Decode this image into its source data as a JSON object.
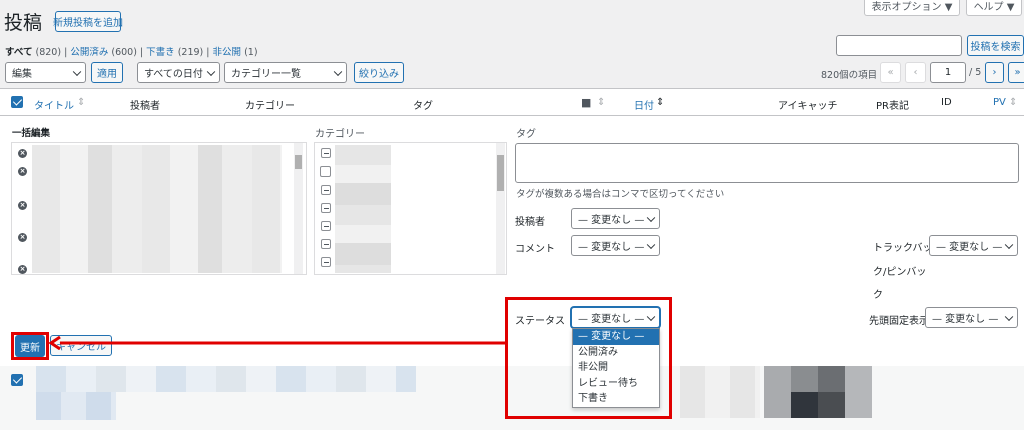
{
  "header": {
    "title": "投稿",
    "add_new": "新規投稿を追加",
    "screen_options": "表示オプション ▼",
    "help": "ヘルプ ▼"
  },
  "filters": {
    "all": "すべて",
    "all_count": "(820)",
    "published": "公開済み",
    "published_count": "(600)",
    "drafts": "下書き",
    "drafts_count": "(219)",
    "private": "非公開",
    "private_count": "(1)"
  },
  "search": {
    "button": "投稿を検索",
    "value": ""
  },
  "toolbar": {
    "bulk_action": "編集",
    "apply": "適用",
    "dates": "すべての日付",
    "categories": "カテゴリー一覧",
    "filter": "絞り込み",
    "items": "820個の項目",
    "first": "«",
    "prev": "‹",
    "page": "1",
    "of_pages": "/ 5",
    "next": "›",
    "last": "»"
  },
  "columns": {
    "title": "タイトル",
    "author": "投稿者",
    "category": "カテゴリー",
    "tag": "タグ",
    "date": "日付",
    "eyecatch": "アイキャッチ",
    "pr": "PR表記",
    "id": "ID",
    "pv": "PV"
  },
  "bulk_edit": {
    "heading": "一括編集",
    "category_label": "カテゴリー",
    "tag_label": "タグ",
    "tag_hint": "タグが複数ある場合はコンマで区切ってください",
    "author_label": "投稿者",
    "comment_label": "コメント",
    "trackback_label_1": "トラックバッ",
    "trackback_label_2": "ク/ピンバッ",
    "trackback_label_3": "ク",
    "status_label": "ステータス",
    "sticky_label": "先頭固定表示",
    "no_change": "— 変更なし —",
    "update": "更新",
    "cancel": "キャンセル"
  },
  "status_options": [
    "— 変更なし —",
    "公開済み",
    "非公開",
    "レビュー待ち",
    "下書き"
  ],
  "colors": {
    "accent": "#2271b1",
    "highlight": "#e00000"
  }
}
